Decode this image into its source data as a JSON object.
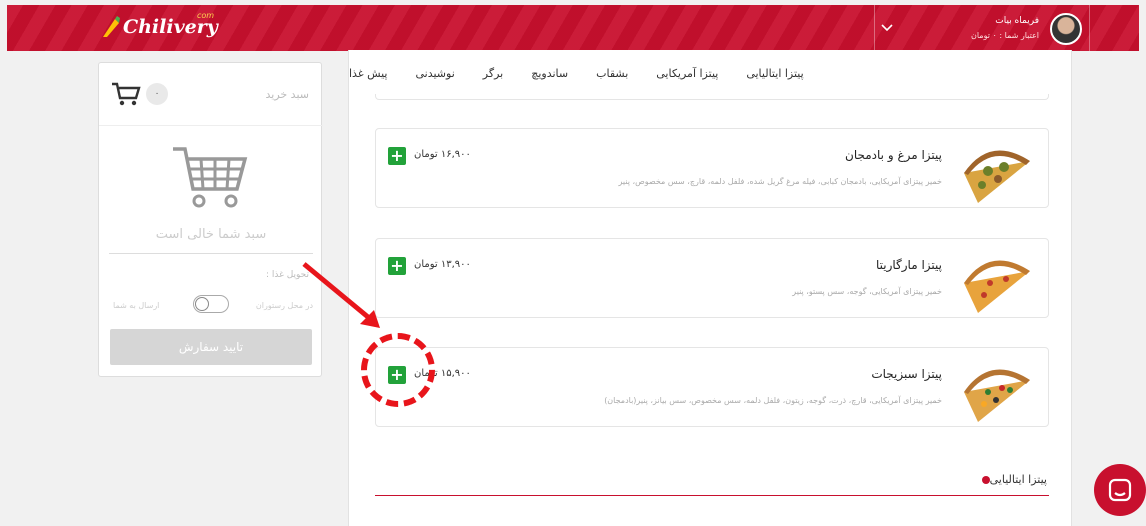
{
  "header": {
    "logo_text": "Chilivery",
    "logo_sup": "com",
    "user_name": "فریماه بیات",
    "user_credit": "اعتبار شما : ۰ تومان"
  },
  "cart": {
    "title": "سبد خرید",
    "count": "۰",
    "empty_text": "سبد شما خالی است",
    "delivery_label": "تحویل غذا :",
    "option_restaurant": "در محل رستوران",
    "option_send": "ارسال به شما",
    "confirm_label": "تایید سفارش"
  },
  "nav": {
    "items": [
      "پیش غذا",
      "نوشیدنی",
      "برگر",
      "ساندویچ",
      "بشقاب",
      "پیتزا آمریکایی",
      "پیتزا ایتالیایی"
    ]
  },
  "menu_items": [
    {
      "name": "پیتزا مرغ و بادمجان",
      "desc": "خمیر پیتزای آمریکایی، بادمجان کبابی، فیله مرغ گریل شده، فلفل دلمه، قارچ، سس مخصوص، پنیر",
      "price": "۱۶,۹۰۰ تومان",
      "add_label": "+"
    },
    {
      "name": "پیتزا مارگاریتا",
      "desc": "خمیر پیتزای آمریکایی، گوجه، سس پستو، پنیر",
      "price": "۱۳,۹۰۰ تومان",
      "add_label": "+"
    },
    {
      "name": "پیتزا سبزیجات",
      "desc": "خمیر پیتزای آمریکایی، قارچ، ذرت، گوجه، زیتون، فلفل دلمه، سس مخصوص، سس بیانز، پنیر(بادمجان)",
      "price": "۱۵,۹۰۰ تومان",
      "add_label": "+"
    }
  ],
  "section": {
    "title": "پیتزا ایتالیایی"
  },
  "colors": {
    "brand_red": "#c8102e",
    "add_green": "#22a23a",
    "annotation_red": "#e8151b"
  }
}
